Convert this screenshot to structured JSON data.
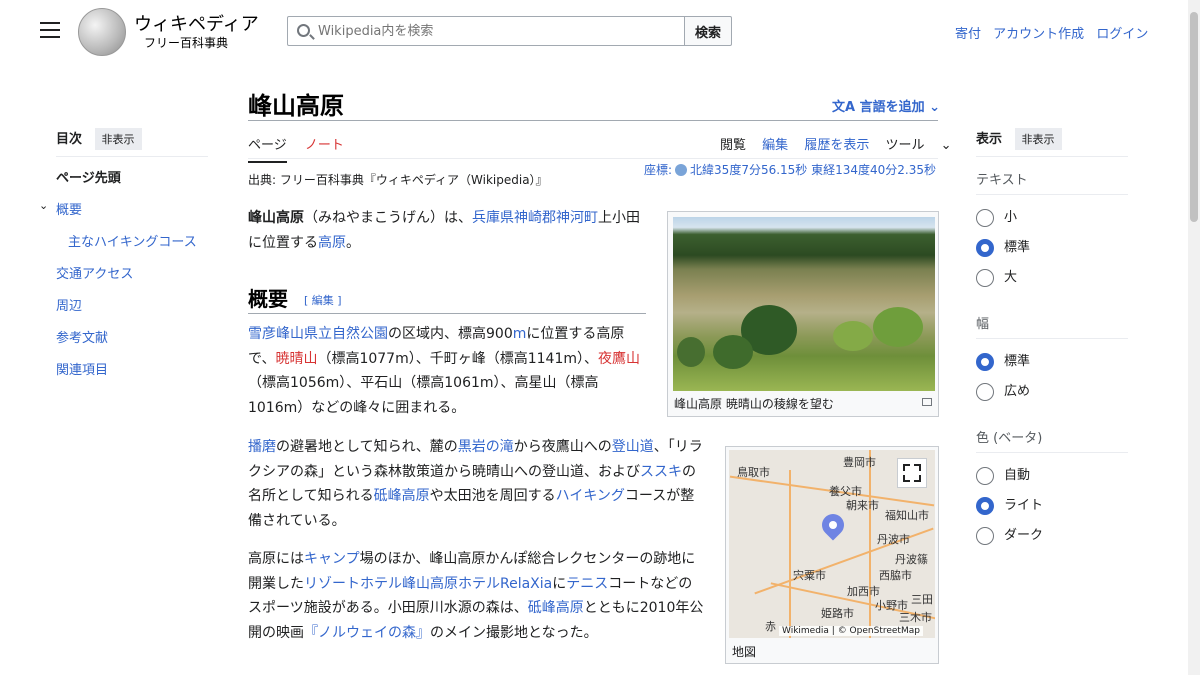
{
  "header": {
    "logo_title": "ウィキペディア",
    "logo_subtitle": "フリー百科事典",
    "search_placeholder": "Wikipedia内を検索",
    "search_button": "検索",
    "user_links": [
      "寄付",
      "アカウント作成",
      "ログイン"
    ]
  },
  "toc": {
    "title": "目次",
    "hide": "非表示",
    "items": [
      {
        "label": "ページ先頭",
        "style": "bold"
      },
      {
        "label": "概要",
        "style": "top"
      },
      {
        "label": "主なハイキングコース",
        "style": "sub"
      },
      {
        "label": "交通アクセス",
        "style": "top"
      },
      {
        "label": "周辺",
        "style": "top"
      },
      {
        "label": "参考文献",
        "style": "top"
      },
      {
        "label": "関連項目",
        "style": "top"
      }
    ]
  },
  "article": {
    "title": "峰山高原",
    "lang_button": "言語を追加",
    "tabs": [
      "ページ",
      "ノート"
    ],
    "actions": [
      "閲覧",
      "編集",
      "履歴を表示",
      "ツール"
    ],
    "coords_label": "座標:",
    "coords_value": "北緯35度7分56.15秒 東経134度40分2.35秒",
    "source": "出典: フリー百科事典『ウィキペディア（Wikipedia）』",
    "intro": [
      {
        "t": "峰山高原",
        "b": true
      },
      {
        "t": "（みねやまこうげん）は、"
      },
      {
        "t": "兵庫県",
        "l": true
      },
      {
        "t": "神崎郡",
        "l": true
      },
      {
        "t": "神河町",
        "l": true
      },
      {
        "t": "上小田に位置する"
      },
      {
        "t": "高原",
        "l": true
      },
      {
        "t": "。"
      }
    ],
    "section_title": "概要",
    "section_edit": "[ 編集 ]",
    "p1": [
      {
        "t": "雪彦峰山県立自然公園",
        "l": true
      },
      {
        "t": "の区域内、標高900"
      },
      {
        "t": "m",
        "l": true
      },
      {
        "t": "に位置する高原で、"
      },
      {
        "t": "暁晴山",
        "r": true
      },
      {
        "t": "（標高1077m）、千町ヶ峰（標高1141m）、"
      },
      {
        "t": "夜鷹山",
        "r": true
      },
      {
        "t": "（標高1056m）、平石山（標高1061m）、高星山（標高1016m）などの峰々に囲まれる。"
      }
    ],
    "p2": [
      {
        "t": "播磨",
        "l": true
      },
      {
        "t": "の避暑地として知られ、麓の"
      },
      {
        "t": "黒岩の滝",
        "l": true
      },
      {
        "t": "から夜鷹山への"
      },
      {
        "t": "登山道",
        "l": true
      },
      {
        "t": "、「リラクシアの森」という森林散策道から暁晴山への登山道、および"
      },
      {
        "t": "ススキ",
        "l": true
      },
      {
        "t": "の名所として知られる"
      },
      {
        "t": "砥峰高原",
        "l": true
      },
      {
        "t": "や太田池を周回する"
      },
      {
        "t": "ハイキング",
        "l": true
      },
      {
        "t": "コースが整備されている。"
      }
    ],
    "p3": [
      {
        "t": "高原には"
      },
      {
        "t": "キャンプ",
        "l": true
      },
      {
        "t": "場のほか、峰山高原かんぽ総合レクセンターの跡地に開業した"
      },
      {
        "t": "リゾートホテル峰山高原ホテルRelaXia",
        "l": true
      },
      {
        "t": "に"
      },
      {
        "t": "テニス",
        "l": true
      },
      {
        "t": "コートなどのスポーツ施設がある。小田原川水源の森は、"
      },
      {
        "t": "砥峰高原",
        "l": true
      },
      {
        "t": "とともに2010年公開の映画"
      },
      {
        "t": "『ノルウェイの森』",
        "l": true
      },
      {
        "t": "のメイン撮影地となった。"
      }
    ],
    "image_caption": "峰山高原 暁晴山の稜線を望む",
    "map_caption": "地図",
    "map_attribution": "Wikimedia | © OpenStreetMap",
    "map_labels": [
      "鳥取市",
      "豊岡市",
      "養父市",
      "朝来市",
      "福知山市",
      "丹波市",
      "丹波篠",
      "宍粟市",
      "西脇市",
      "加西市",
      "小野市",
      "三田",
      "三木市",
      "姫路市",
      "赤"
    ]
  },
  "appearance": {
    "title": "表示",
    "hide": "非表示",
    "groups": [
      {
        "label": "テキスト",
        "options": [
          "小",
          "標準",
          "大"
        ],
        "selected": 1
      },
      {
        "label": "幅",
        "options": [
          "標準",
          "広め"
        ],
        "selected": 0
      },
      {
        "label": "色 (ベータ)",
        "options": [
          "自動",
          "ライト",
          "ダーク"
        ],
        "selected": 1
      }
    ]
  }
}
